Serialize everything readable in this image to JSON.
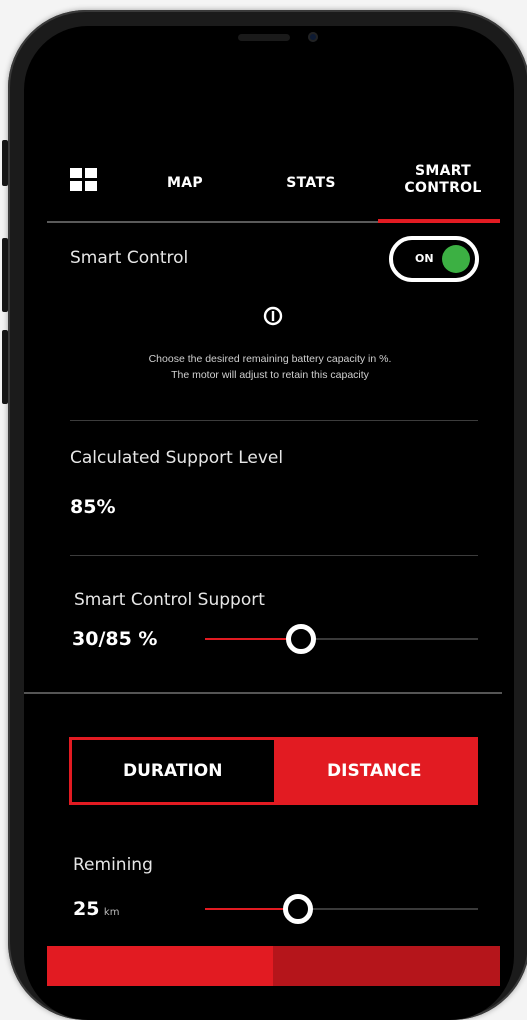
{
  "tabs": {
    "items": [
      {
        "label": "MAP"
      },
      {
        "label": "STATS"
      },
      {
        "label": "SMART\nCONTROL"
      }
    ],
    "active_index": 2
  },
  "smart_control": {
    "label": "Smart Control",
    "toggle_label": "ON",
    "toggle_on": true,
    "description_line1": "Choose the desired remaining battery capacity in %.",
    "description_line2": "The motor will adjust to retain this capacity"
  },
  "calculated": {
    "label": "Calculated Support Level",
    "value": "85%"
  },
  "support": {
    "label": "Smart Control Support",
    "value": "30/85 %",
    "slider_fraction": 0.35
  },
  "mode": {
    "options": [
      "DURATION",
      "DISTANCE"
    ],
    "selected": "DISTANCE"
  },
  "remaining": {
    "label": "Remining",
    "value": "25",
    "unit": "km",
    "slider_fraction": 0.34
  },
  "colors": {
    "accent": "#e21b22",
    "toggle_on": "#3cb043",
    "background": "#000000"
  }
}
